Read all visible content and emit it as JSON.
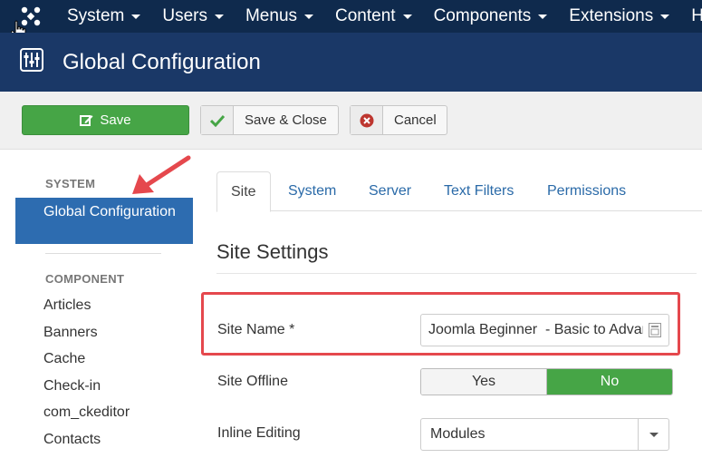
{
  "topnav": {
    "logo_icon": "joomla-logo-icon",
    "menu": [
      {
        "label": "System"
      },
      {
        "label": "Users"
      },
      {
        "label": "Menus"
      },
      {
        "label": "Content"
      },
      {
        "label": "Components"
      },
      {
        "label": "Extensions"
      },
      {
        "label": "H"
      }
    ]
  },
  "header": {
    "title": "Global Configuration",
    "icon": "sliders-icon"
  },
  "toolbar": {
    "save_label": "Save",
    "save_close_label": "Save & Close",
    "cancel_label": "Cancel"
  },
  "sidebar": {
    "system_heading": "SYSTEM",
    "active_item": "Global Configuration",
    "component_heading": "COMPONENT",
    "items": [
      "Articles",
      "Banners",
      "Cache",
      "Check-in",
      "com_ckeditor",
      "Contacts"
    ]
  },
  "tabs": [
    {
      "label": "Site",
      "active": true
    },
    {
      "label": "System"
    },
    {
      "label": "Server"
    },
    {
      "label": "Text Filters"
    },
    {
      "label": "Permissions"
    }
  ],
  "section": {
    "title": "Site Settings"
  },
  "form": {
    "site_name_label": "Site Name *",
    "site_name_value": "Joomla Beginner  - Basic to Advanced",
    "site_offline_label": "Site Offline",
    "site_offline_yes": "Yes",
    "site_offline_no": "No",
    "site_offline_selected": "No",
    "inline_editing_label": "Inline Editing",
    "inline_editing_value": "Modules"
  },
  "colors": {
    "topnav_bg": "#0f2a4d",
    "header_bg": "#1a3867",
    "accent_green": "#46a546",
    "sidebar_active": "#2d6cb0",
    "link_blue": "#2a6aa8",
    "annotation_red": "#e5484d"
  }
}
